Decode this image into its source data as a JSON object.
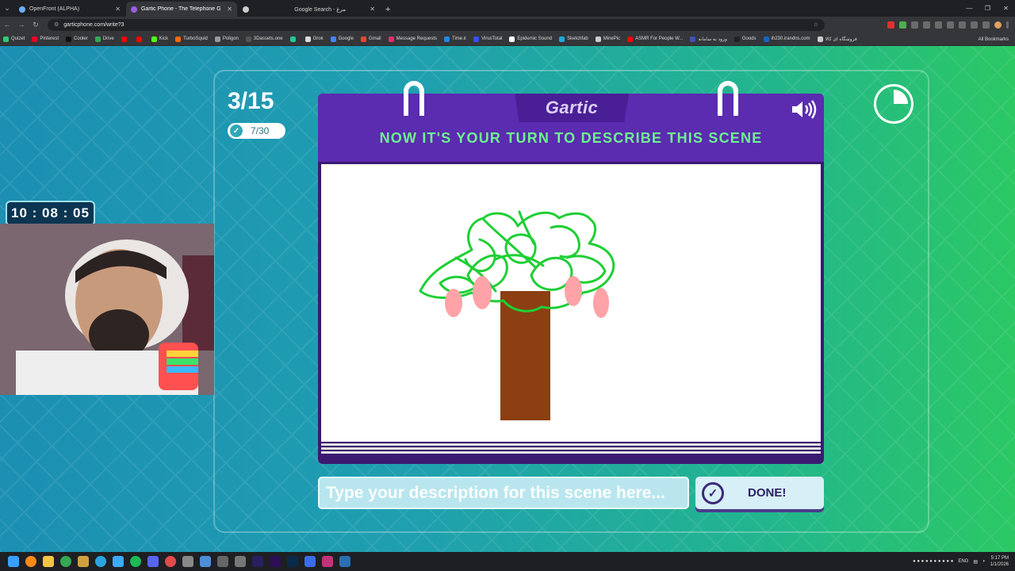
{
  "browser": {
    "tabs": [
      {
        "title": "OpenFront (ALPHA)",
        "active": false,
        "color": "#6ab0ff"
      },
      {
        "title": "Gartic Phone - The Telephone G",
        "active": true,
        "color": "#9b5de5"
      },
      {
        "title": "",
        "active": false,
        "color": "#cccccc"
      },
      {
        "title": "Google Search - مرغ",
        "active": false,
        "color": "#4285f4"
      }
    ],
    "url": "garticphone.com/write?3",
    "bookmarks": [
      {
        "label": "Quizet",
        "color": "#2ecc71"
      },
      {
        "label": "Pinterest",
        "color": "#e60023"
      },
      {
        "label": "Cooler",
        "color": "#111111"
      },
      {
        "label": "Drive",
        "color": "#34a853"
      },
      {
        "label": "",
        "color": "#ff0000"
      },
      {
        "label": "",
        "color": "#ff0000"
      },
      {
        "label": "Kick",
        "color": "#53fc18"
      },
      {
        "label": "TurboSquid",
        "color": "#ff6a00"
      },
      {
        "label": "Poligon",
        "color": "#999999"
      },
      {
        "label": "3Dassets.one",
        "color": "#555555"
      },
      {
        "label": "",
        "color": "#20c997"
      },
      {
        "label": "Grok",
        "color": "#dddddd"
      },
      {
        "label": "Google",
        "color": "#4285f4"
      },
      {
        "label": "Gmail",
        "color": "#ea4335"
      },
      {
        "label": "Message Requests",
        "color": "#e1306c"
      },
      {
        "label": "Time.ir",
        "color": "#1e88e5"
      },
      {
        "label": "VirusTotal",
        "color": "#394eff"
      },
      {
        "label": "Epidemic Sound",
        "color": "#ffffff"
      },
      {
        "label": "Sketchfab",
        "color": "#1caad9"
      },
      {
        "label": "MinePic",
        "color": "#cccccc"
      },
      {
        "label": "ASMR For People W...",
        "color": "#ff0000"
      },
      {
        "label": "ورود به سامانه",
        "color": "#3f51b5"
      },
      {
        "label": "Goods",
        "color": "#222222"
      },
      {
        "label": "ih230.irandns.com",
        "color": "#1565c0"
      },
      {
        "label": "فروشگاه ای کالا",
        "color": "#cccccc"
      }
    ],
    "all_bookmarks": "All Bookmarks"
  },
  "game": {
    "round": "3/15",
    "players_done": "7/30",
    "logo": "Gartic",
    "heading": "NOW IT'S YOUR TURN TO DESCRIBE THIS SCENE",
    "input_placeholder": "Type your description for this scene here...",
    "input_value": "",
    "done_label": "DONE!",
    "timer_elapsed_fraction": 0.25,
    "colors": {
      "header": "#5b2bb0",
      "accent_green": "#6ff28f",
      "trunk": "#8b3f12",
      "leaves": "#1fcf34",
      "blossom": "#ffa3a8"
    }
  },
  "overlay": {
    "clock": "10 : 08 : 05"
  },
  "taskbar": {
    "language": "ENG",
    "time": "5:17 PM",
    "date": "1/1/2026"
  }
}
